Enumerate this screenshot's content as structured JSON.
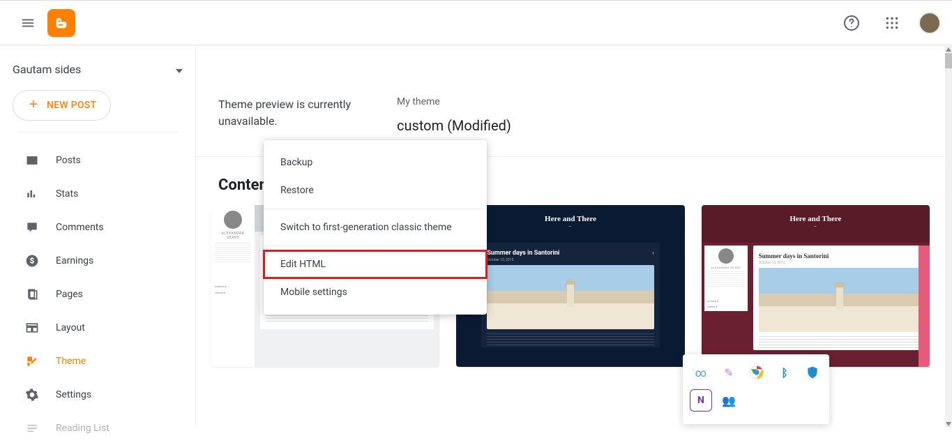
{
  "header": {
    "blog_name": "Gautam sides"
  },
  "sidebar": {
    "new_post_label": "NEW POST",
    "nav": [
      {
        "id": "posts",
        "label": "Posts"
      },
      {
        "id": "stats",
        "label": "Stats"
      },
      {
        "id": "comments",
        "label": "Comments"
      },
      {
        "id": "earnings",
        "label": "Earnings"
      },
      {
        "id": "pages",
        "label": "Pages"
      },
      {
        "id": "layout",
        "label": "Layout"
      },
      {
        "id": "theme",
        "label": "Theme",
        "active": true
      },
      {
        "id": "settings",
        "label": "Settings"
      },
      {
        "id": "reading-list",
        "label": "Reading List"
      }
    ]
  },
  "main": {
    "preview_unavailable": "Theme preview is currently unavailable.",
    "my_theme_label": "My theme",
    "theme_name": "custom (Modified)",
    "section_heading": "Conten",
    "card_blog_title": "Here and There",
    "card_blog_subtitle": "—",
    "card_post_title": "Summer days in Santorini",
    "card_post_date": "October 10, 2015",
    "card_author": "ALEXANDRA GEARS"
  },
  "dropdown": {
    "items": [
      {
        "id": "backup",
        "label": "Backup"
      },
      {
        "id": "restore",
        "label": "Restore"
      },
      {
        "id": "switch-classic",
        "label": "Switch to first-generation classic theme"
      },
      {
        "id": "edit-html",
        "label": "Edit HTML",
        "highlighted": true
      },
      {
        "id": "mobile-settings",
        "label": "Mobile settings"
      }
    ]
  },
  "taskbar": {
    "apps": [
      {
        "id": "vscode",
        "glyph": "∞",
        "color": "#4aa0e8"
      },
      {
        "id": "feather",
        "glyph": "✎",
        "color": "#b97fe0"
      },
      {
        "id": "chrome",
        "glyph": "◉",
        "color": "#4285f4"
      },
      {
        "id": "bluetooth",
        "glyph": "ᛒ",
        "color": "#1e88e5"
      },
      {
        "id": "defender",
        "glyph": "✔",
        "color": "#16a34a"
      },
      {
        "id": "onenote",
        "glyph": "N",
        "color": "#7b2fbf"
      },
      {
        "id": "teams",
        "glyph": "T",
        "color": "#5b5fc7"
      }
    ]
  }
}
